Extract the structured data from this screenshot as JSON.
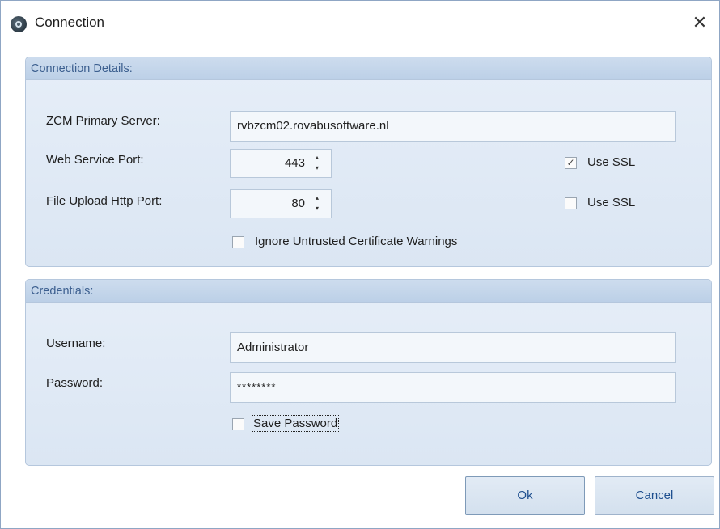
{
  "window": {
    "title": "Connection",
    "close_glyph": "✕"
  },
  "connection_details": {
    "header": "Connection Details:",
    "primary_server": {
      "label": "ZCM Primary Server:",
      "value": "rvbzcm02.rovabusoftware.nl"
    },
    "web_service_port": {
      "label": "Web Service Port:",
      "value": "443",
      "use_ssl_label": "Use SSL",
      "use_ssl_checked": true
    },
    "file_upload_port": {
      "label": "File Upload Http Port:",
      "value": "80",
      "use_ssl_label": "Use SSL",
      "use_ssl_checked": false
    },
    "ignore_cert": {
      "label": "Ignore Untrusted Certificate Warnings",
      "checked": false
    }
  },
  "credentials": {
    "header": "Credentials:",
    "username": {
      "label": "Username:",
      "value": "Administrator"
    },
    "password": {
      "label": "Password:",
      "value": "********"
    },
    "save_password": {
      "label": "Save Password",
      "checked": false
    }
  },
  "buttons": {
    "ok": "Ok",
    "cancel": "Cancel"
  },
  "icons": {
    "app": "app-logo-icon",
    "close": "close-icon",
    "spin_up": "▴",
    "spin_down": "▾",
    "check": "✓"
  },
  "colors": {
    "group_header_text": "#3c5f8f",
    "button_text": "#1e4f8f",
    "group_border": "#b5c7dd"
  }
}
